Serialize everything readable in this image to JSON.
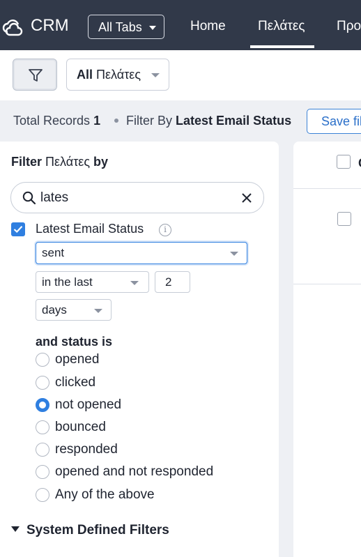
{
  "header": {
    "app_name": "CRM",
    "all_tabs_label": "All Tabs",
    "nav": [
      {
        "label": "Home"
      },
      {
        "label": "Πελάτες",
        "active": true
      },
      {
        "label": "Προ"
      }
    ]
  },
  "toolbar": {
    "view_select_bold": "All",
    "view_select_rest": "Πελάτες"
  },
  "infobar": {
    "total_label": "Total Records",
    "total_count": "1",
    "filter_by_label": "Filter By",
    "filter_by_value": "Latest Email Status",
    "save_button": "Save fil"
  },
  "filter_panel": {
    "title_prefix": "Filter",
    "title_module": "Πελάτες",
    "title_suffix": "by",
    "search_value": "lates",
    "field": {
      "label": "Latest Email Status",
      "checked": true,
      "action_select": "sent",
      "range_select": "in the last",
      "range_value": "2",
      "unit_select": "days"
    },
    "status_heading": "and status is",
    "statuses": [
      {
        "label": "opened",
        "selected": false
      },
      {
        "label": "clicked",
        "selected": false
      },
      {
        "label": "not opened",
        "selected": true
      },
      {
        "label": "bounced",
        "selected": false
      },
      {
        "label": "responded",
        "selected": false
      },
      {
        "label": "opened and not responded",
        "selected": false
      },
      {
        "label": "Any of the above",
        "selected": false
      }
    ],
    "system_defined_label": "System Defined Filters"
  },
  "table": {
    "column_header_fragment": "C"
  },
  "colors": {
    "topbar": "#313949",
    "accent": "#2f7fe0",
    "page_bg": "#eef0f4"
  },
  "icons": [
    "cloud-logo-icon",
    "caret-down-icon",
    "filter-funnel-icon",
    "search-icon",
    "clear-x-icon",
    "checkbox-checked-icon",
    "info-icon",
    "radio-icon",
    "collapse-triangle-icon"
  ]
}
